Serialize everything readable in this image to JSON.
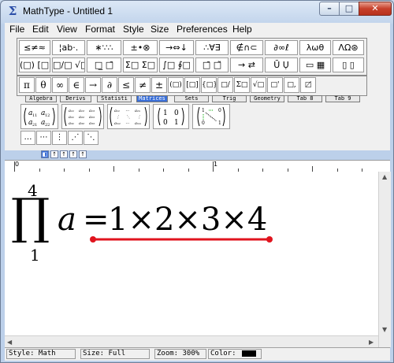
{
  "window": {
    "title": "MathType - Untitled 1",
    "app_icon": "sigma-icon",
    "controls": {
      "minimize": "–",
      "maximize": "□",
      "close": "✕"
    }
  },
  "menu": [
    "File",
    "Edit",
    "View",
    "Format",
    "Style",
    "Size",
    "Preferences",
    "Help"
  ],
  "toolbar": {
    "row1": [
      "≤≠≈",
      "¦ab·.",
      "∗∵∴",
      "±•⊗",
      "→⇔↓",
      "∴∀∃",
      "∉∩⊂",
      "∂∞ℓ",
      "λωθ",
      "ΛΩ⊛"
    ],
    "row2": [
      "(□) [□]",
      "□/□ √□",
      "□̲ □̄",
      "Σ□ Σ□",
      "∫□ ∮□",
      "□̄ □̃",
      "→ ⇄",
      "Ū Ụ",
      "▭ ▦",
      "▯ ▯"
    ],
    "row3": [
      "π",
      "θ",
      "∞",
      "∈",
      "→",
      "∂",
      "≤",
      "≠",
      "±",
      "(□)",
      "[□]",
      "{□}",
      "□/□",
      "Σ□",
      "√□",
      "□'",
      "□,",
      "□̸"
    ],
    "tabs": [
      "Algebra",
      "Derivs",
      "Statisti",
      "Matrices",
      "Sets",
      "Trig",
      "Geometry",
      "Tab 8",
      "Tab 9"
    ],
    "active_tab": "Matrices",
    "templates": [
      "(a11 a12 / a21 a22)",
      "(3×3 matrix)",
      "(m×n matrix)",
      "(1 0 / 0 1)",
      "(1 0 / 0 1) dotted"
    ],
    "small_row": [
      "…",
      "⋯",
      "⋮",
      "⋰",
      "⋱"
    ],
    "nudge": [
      "◧",
      "↑",
      "↑",
      "↑",
      "↑"
    ]
  },
  "ruler": {
    "labels": [
      "0",
      "1"
    ]
  },
  "equation": {
    "operator": "∏",
    "upper": "4",
    "lower": "1",
    "body": "a",
    "equals": "=",
    "rhs": "1×2×3×4"
  },
  "status": {
    "style": "Style: Math",
    "size": "Size: Full",
    "zoom": "Zoom: 300%",
    "color_label": "Color:",
    "color": "#000000"
  },
  "colors": {
    "underline": "#e0141e",
    "accent_tab": "#3a6fd8"
  }
}
